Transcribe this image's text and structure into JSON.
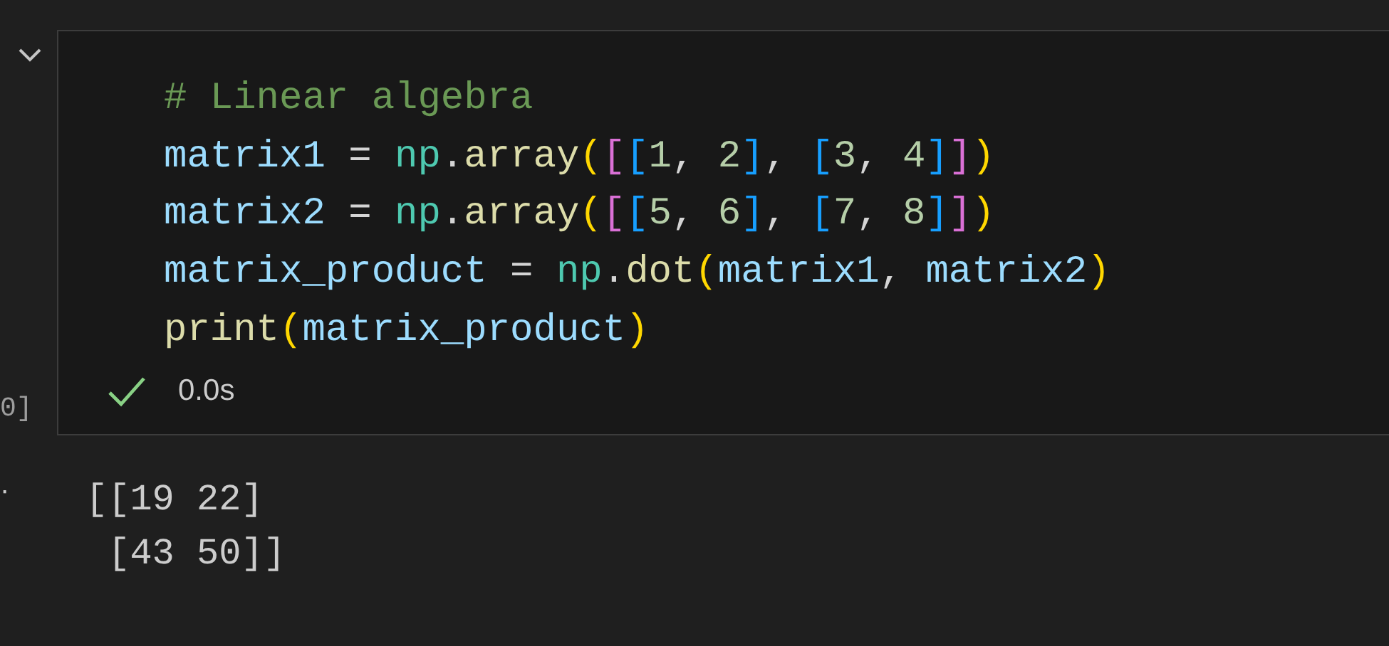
{
  "cell": {
    "expanded": true,
    "execution_count": "0]",
    "code_lines": [
      [
        {
          "kind": "comment",
          "text": "# Linear algebra"
        }
      ],
      [
        {
          "kind": "variable",
          "text": "matrix1"
        },
        {
          "kind": "plain",
          "text": " = "
        },
        {
          "kind": "module",
          "text": "np"
        },
        {
          "kind": "plain",
          "text": "."
        },
        {
          "kind": "function",
          "text": "array"
        },
        {
          "kind": "bracket1",
          "text": "("
        },
        {
          "kind": "bracket2",
          "text": "["
        },
        {
          "kind": "bracket3",
          "text": "["
        },
        {
          "kind": "number",
          "text": "1"
        },
        {
          "kind": "plain",
          "text": ", "
        },
        {
          "kind": "number",
          "text": "2"
        },
        {
          "kind": "bracket3",
          "text": "]"
        },
        {
          "kind": "plain",
          "text": ", "
        },
        {
          "kind": "bracket3",
          "text": "["
        },
        {
          "kind": "number",
          "text": "3"
        },
        {
          "kind": "plain",
          "text": ", "
        },
        {
          "kind": "number",
          "text": "4"
        },
        {
          "kind": "bracket3",
          "text": "]"
        },
        {
          "kind": "bracket2",
          "text": "]"
        },
        {
          "kind": "bracket1",
          "text": ")"
        }
      ],
      [
        {
          "kind": "variable",
          "text": "matrix2"
        },
        {
          "kind": "plain",
          "text": " = "
        },
        {
          "kind": "module",
          "text": "np"
        },
        {
          "kind": "plain",
          "text": "."
        },
        {
          "kind": "function",
          "text": "array"
        },
        {
          "kind": "bracket1",
          "text": "("
        },
        {
          "kind": "bracket2",
          "text": "["
        },
        {
          "kind": "bracket3",
          "text": "["
        },
        {
          "kind": "number",
          "text": "5"
        },
        {
          "kind": "plain",
          "text": ", "
        },
        {
          "kind": "number",
          "text": "6"
        },
        {
          "kind": "bracket3",
          "text": "]"
        },
        {
          "kind": "plain",
          "text": ", "
        },
        {
          "kind": "bracket3",
          "text": "["
        },
        {
          "kind": "number",
          "text": "7"
        },
        {
          "kind": "plain",
          "text": ", "
        },
        {
          "kind": "number",
          "text": "8"
        },
        {
          "kind": "bracket3",
          "text": "]"
        },
        {
          "kind": "bracket2",
          "text": "]"
        },
        {
          "kind": "bracket1",
          "text": ")"
        }
      ],
      [
        {
          "kind": "variable",
          "text": "matrix_product"
        },
        {
          "kind": "plain",
          "text": " = "
        },
        {
          "kind": "module",
          "text": "np"
        },
        {
          "kind": "plain",
          "text": "."
        },
        {
          "kind": "function",
          "text": "dot"
        },
        {
          "kind": "bracket1",
          "text": "("
        },
        {
          "kind": "variable",
          "text": "matrix1"
        },
        {
          "kind": "plain",
          "text": ", "
        },
        {
          "kind": "variable",
          "text": "matrix2"
        },
        {
          "kind": "bracket1",
          "text": ")"
        }
      ],
      [
        {
          "kind": "function",
          "text": "print"
        },
        {
          "kind": "bracket1",
          "text": "("
        },
        {
          "kind": "variable",
          "text": "matrix_product"
        },
        {
          "kind": "bracket1",
          "text": ")"
        }
      ]
    ],
    "status": {
      "success": true,
      "duration": "0.0s"
    },
    "output_marker": "·",
    "output_lines": [
      "[[19 22]",
      " [43 50]]"
    ]
  }
}
